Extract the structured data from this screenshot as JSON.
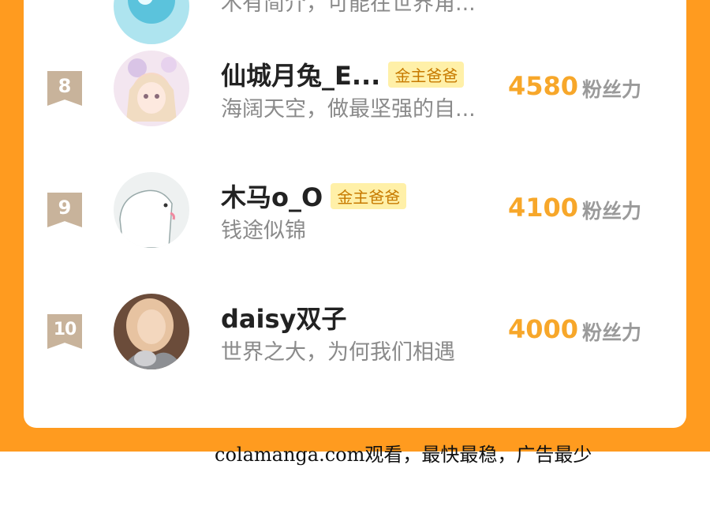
{
  "leaderboard": {
    "top_partial": {
      "desc": "木有简介，可能在世界角..."
    },
    "entries": [
      {
        "rank": "8",
        "name": "仙城月兔_E...",
        "badge": "金主爸爸",
        "desc": "海阔天空，做最坚强的自...",
        "score": "4580",
        "unit": "粉丝力"
      },
      {
        "rank": "9",
        "name": "木马o_O",
        "badge": "金主爸爸",
        "desc": "钱途似锦",
        "score": "4100",
        "unit": "粉丝力"
      },
      {
        "rank": "10",
        "name": "daisy双子",
        "badge": "",
        "desc": "世界之大，为何我们相遇",
        "score": "4000",
        "unit": "粉丝力"
      }
    ]
  },
  "footer": {
    "watermark": "colamanga.com观看，最快最稳，广告最少"
  },
  "colors": {
    "frame": "#ff9b1f",
    "score": "#f7a72a",
    "rank_badge": "#c8b39b",
    "vip_badge_bg": "#fff0a8"
  }
}
